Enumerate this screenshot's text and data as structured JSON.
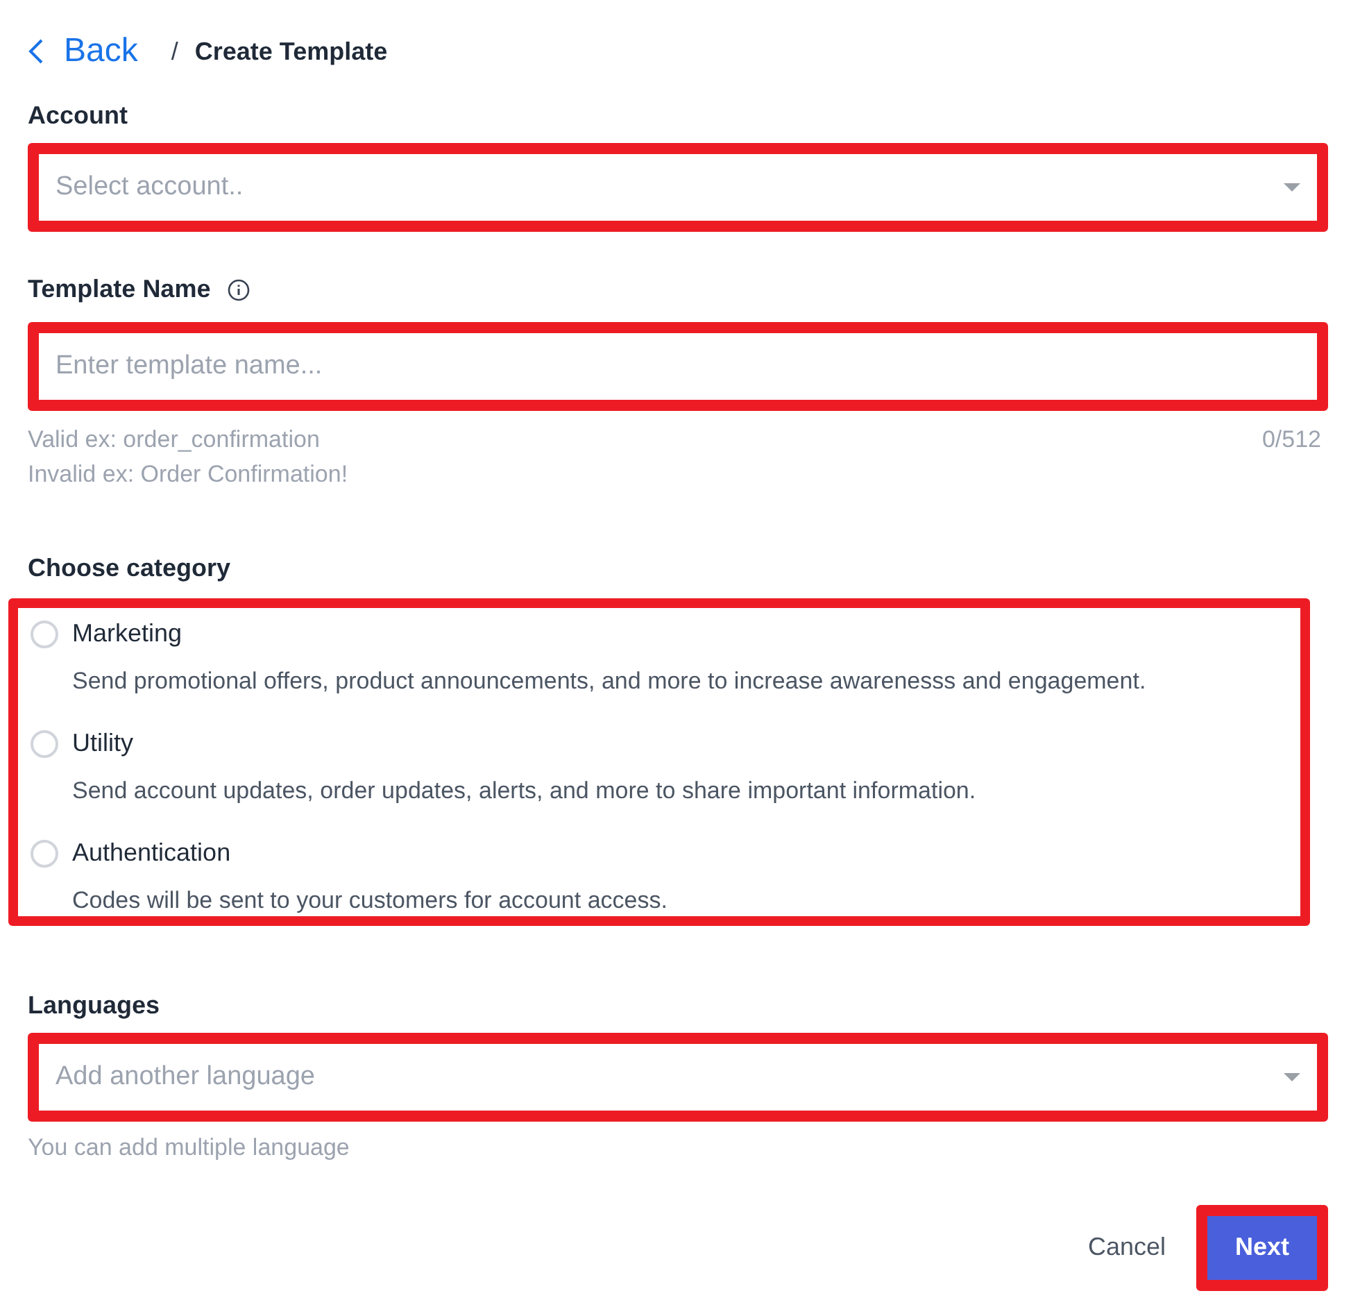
{
  "breadcrumb": {
    "back": "Back",
    "separator": "/",
    "current": "Create Template"
  },
  "account": {
    "label": "Account",
    "placeholder": "Select account.."
  },
  "template_name": {
    "label": "Template Name",
    "placeholder": "Enter template name...",
    "hints": [
      "Valid ex: order_confirmation",
      "Invalid ex: Order Confirmation!"
    ],
    "counter": "0/512"
  },
  "category": {
    "label": "Choose category",
    "options": [
      {
        "title": "Marketing",
        "description": "Send promotional offers, product announcements, and more to increase awarenesss and engagement.",
        "selected": false
      },
      {
        "title": "Utility",
        "description": "Send account updates, order updates, alerts, and more to share important information.",
        "selected": false
      },
      {
        "title": "Authentication",
        "description": "Codes will be sent to your customers for account access.",
        "selected": false
      }
    ]
  },
  "languages": {
    "label": "Languages",
    "placeholder": "Add another language",
    "hint": "You can add multiple language"
  },
  "actions": {
    "cancel": "Cancel",
    "next": "Next"
  }
}
